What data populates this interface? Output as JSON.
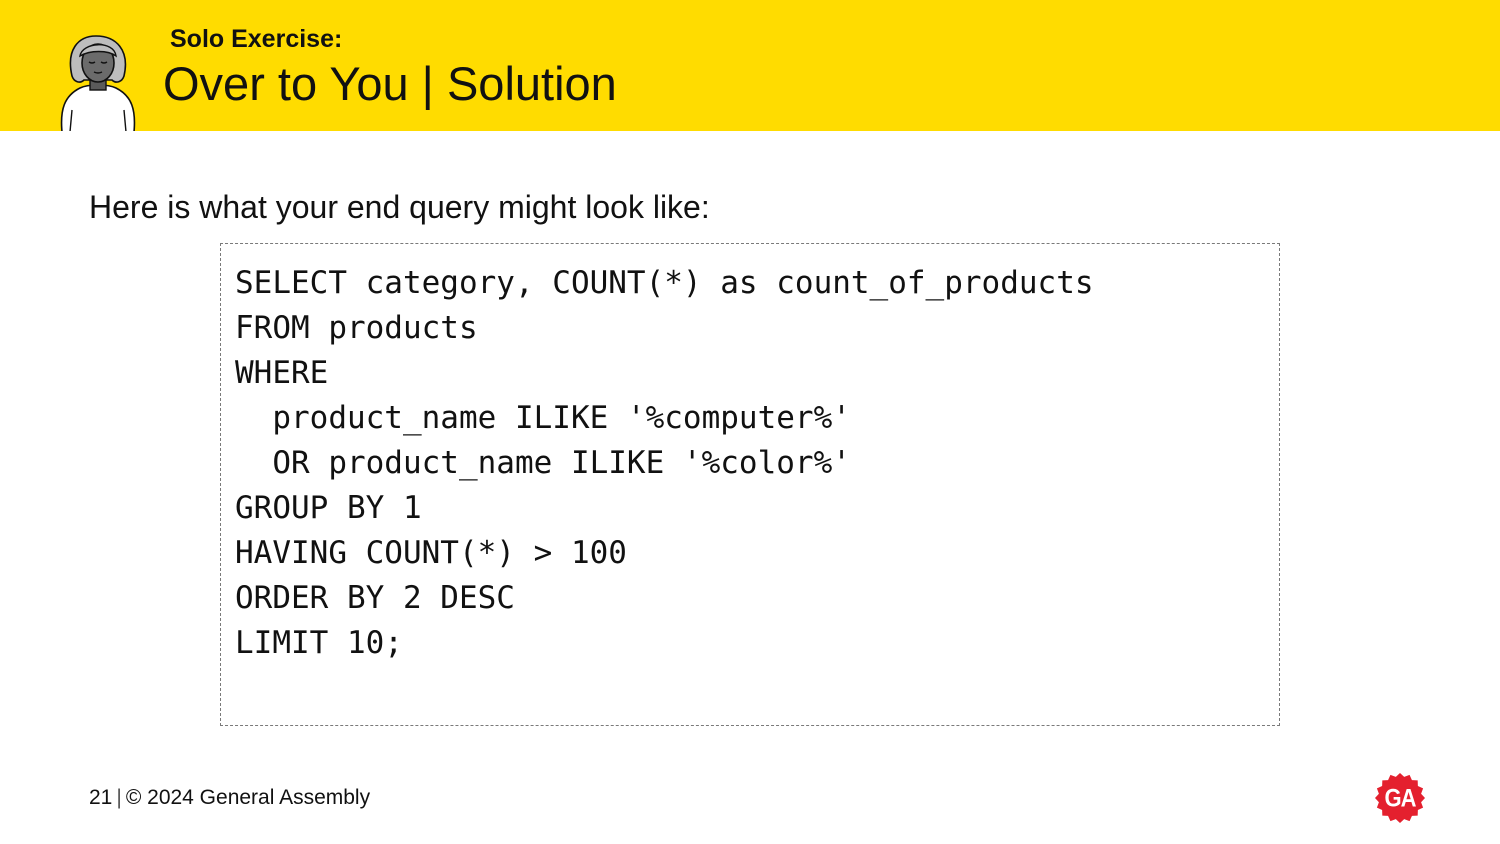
{
  "header": {
    "eyebrow": "Solo Exercise:",
    "title": "Over to You | Solution",
    "background_color": "#FFDC00",
    "avatar_icon": "person-avatar-icon"
  },
  "intro": "Here is what your end query might look like:",
  "code_lines": [
    "SELECT category, COUNT(*) as count_of_products",
    "FROM products",
    "WHERE",
    "  product_name ILIKE '%computer%'",
    "  OR product_name ILIKE '%color%'",
    "GROUP BY 1",
    "HAVING COUNT(*) > 100",
    "ORDER BY 2 DESC",
    "LIMIT 10;"
  ],
  "footer": {
    "page_number": "21",
    "separator": "|",
    "copyright": "© 2024 General Assembly"
  },
  "logo": {
    "text": "GA",
    "color": "#E4202E"
  }
}
